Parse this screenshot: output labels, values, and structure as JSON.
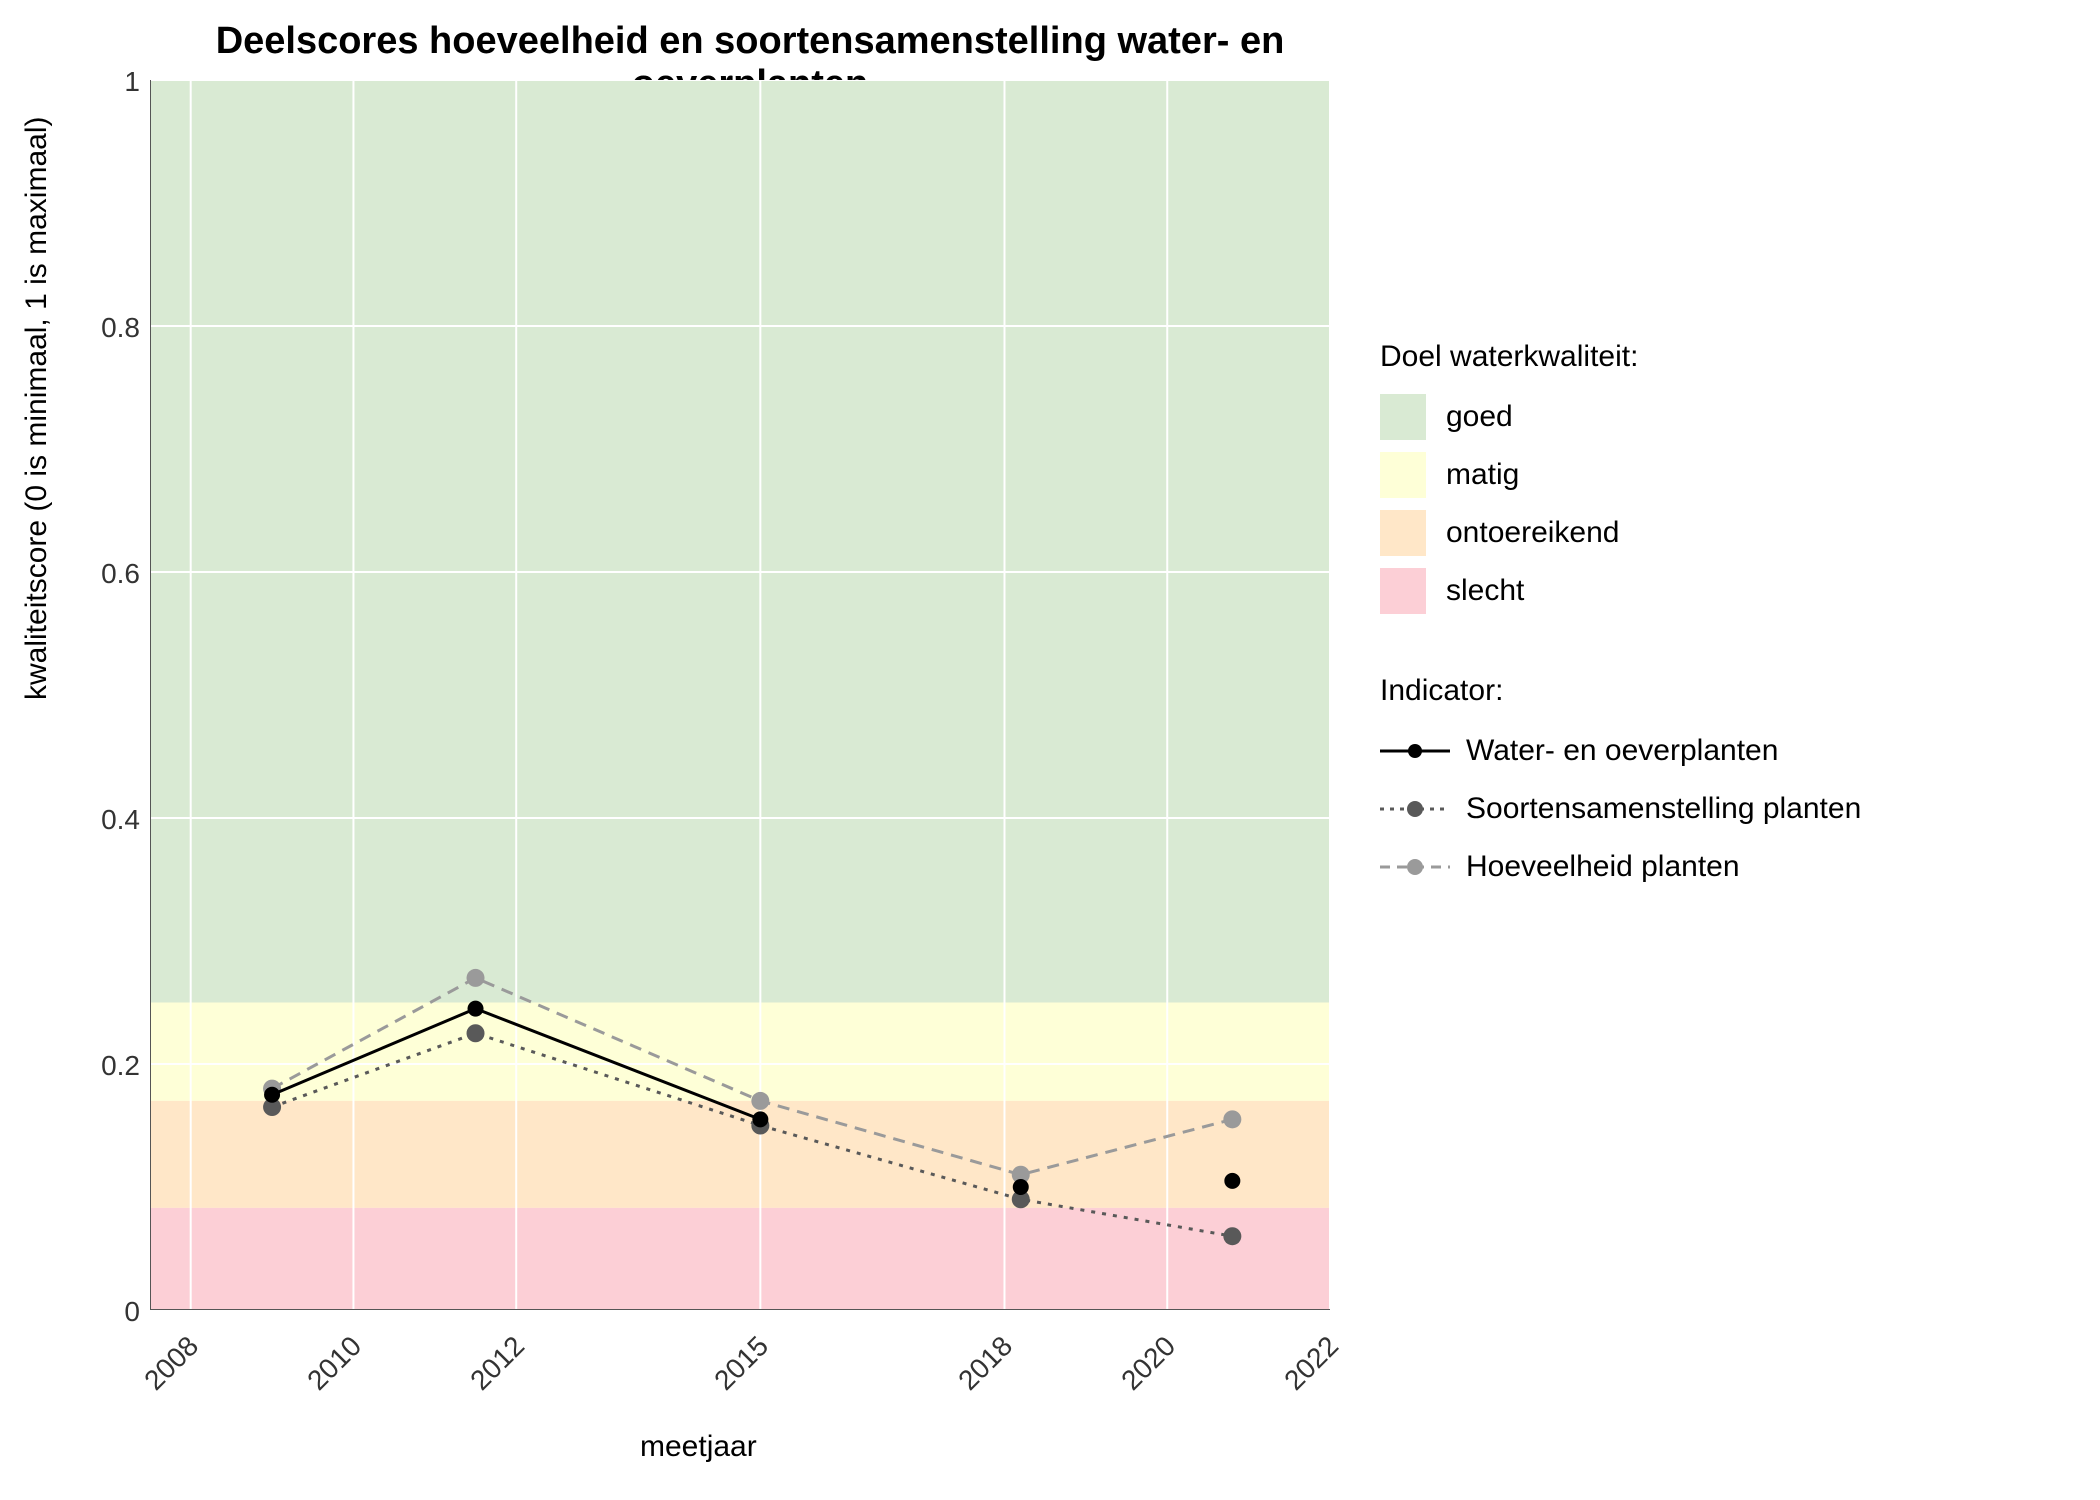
{
  "chart_data": {
    "type": "line",
    "title": "Deelscores hoeveelheid en soortensamenstelling water- en oeverplanten",
    "xlabel": "meetjaar",
    "ylabel": "kwaliteitscore (0 is minimaal, 1 is maximaal)",
    "xlim": [
      2007.5,
      2022
    ],
    "ylim": [
      0,
      1.0
    ],
    "xticks": [
      2008,
      2010,
      2012,
      2015,
      2018,
      2020,
      2022
    ],
    "yticks": [
      0.0,
      0.2,
      0.4,
      0.6,
      0.8,
      1.0
    ],
    "bands": [
      {
        "name": "goed",
        "y0": 0.25,
        "y1": 1.0,
        "color": "#d9ead3"
      },
      {
        "name": "matig",
        "y0": 0.17,
        "y1": 0.25,
        "color": "#feffd7"
      },
      {
        "name": "ontoereikend",
        "y0": 0.083,
        "y1": 0.17,
        "color": "#ffe7c8"
      },
      {
        "name": "slecht",
        "y0": 0.0,
        "y1": 0.083,
        "color": "#fccfd6"
      }
    ],
    "series": [
      {
        "name": "Water- en oeverplanten",
        "color": "#000000",
        "dash": "solid",
        "x": [
          2009,
          2011.5,
          2015,
          2018.2,
          2020.8
        ],
        "values": [
          0.175,
          0.245,
          0.155,
          0.1,
          0.105
        ]
      },
      {
        "name": "Soortensamenstelling planten",
        "color": "#595959",
        "dash": "dotted",
        "x": [
          2009,
          2011.5,
          2015,
          2018.2,
          2020.8
        ],
        "values": [
          0.165,
          0.225,
          0.15,
          0.09,
          0.06
        ]
      },
      {
        "name": "Hoeveelheid planten",
        "color": "#9a9a9a",
        "dash": "dashed",
        "x": [
          2009,
          2011.5,
          2015,
          2018.2,
          2020.8
        ],
        "values": [
          0.18,
          0.27,
          0.17,
          0.11,
          0.155
        ]
      }
    ],
    "legend_quality_title": "Doel waterkwaliteit:",
    "legend_indicator_title": "Indicator:"
  }
}
